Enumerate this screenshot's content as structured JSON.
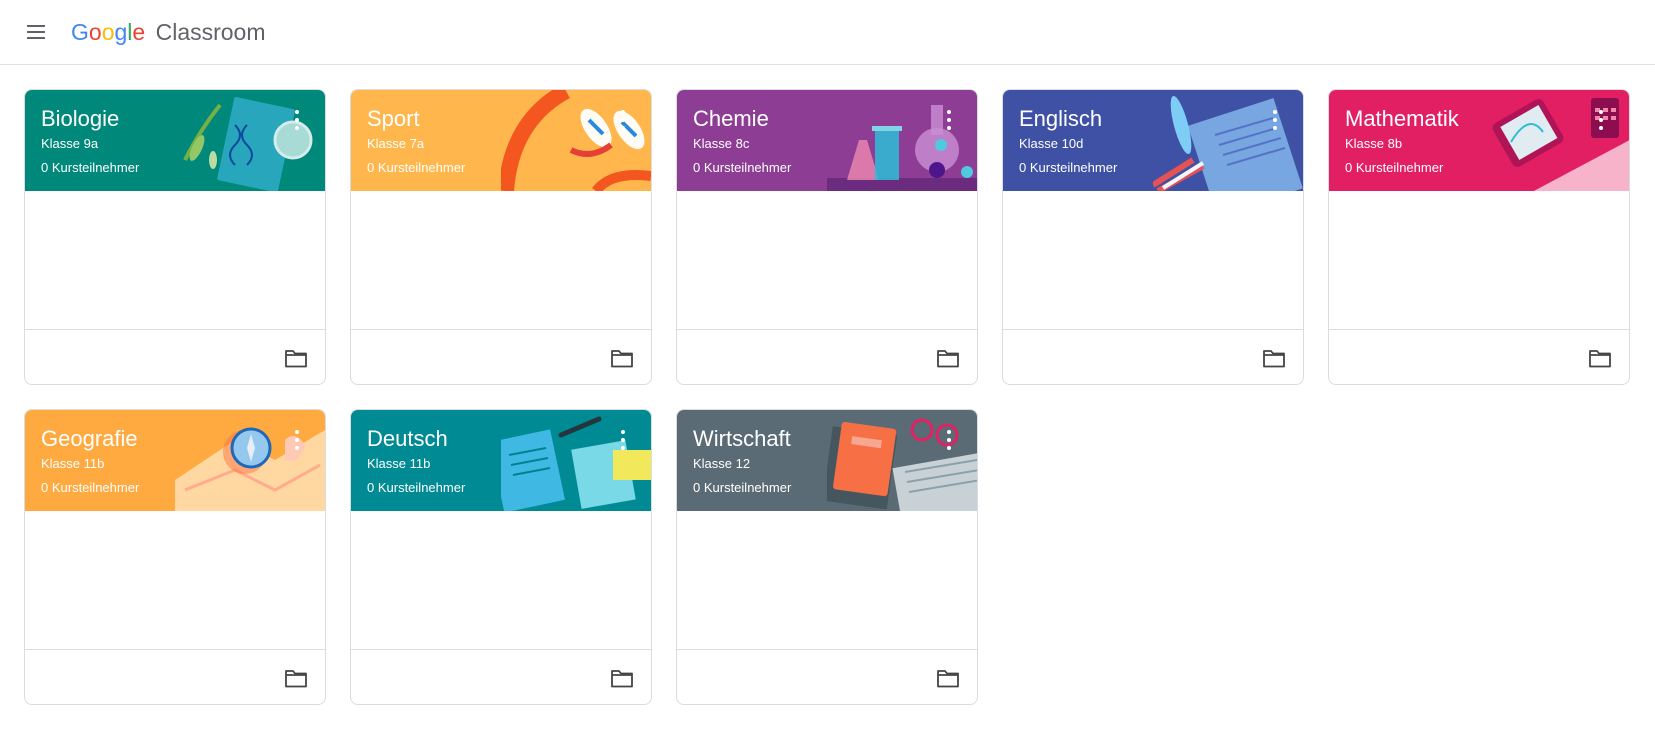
{
  "header": {
    "logo_google": [
      "G",
      "o",
      "o",
      "g",
      "l",
      "e"
    ],
    "logo_google_colors": [
      "#4285F4",
      "#EA4335",
      "#FBBC05",
      "#4285F4",
      "#34A853",
      "#EA4335"
    ],
    "logo_product": "Classroom",
    "menu_icon": "hamburger-menu-icon"
  },
  "courses": [
    {
      "title": "Biologie",
      "section": "Klasse 9a",
      "students": "0 Kursteilnehmer",
      "color": "#00897b",
      "art": "biology-illustration"
    },
    {
      "title": "Sport",
      "section": "Klasse 7a",
      "students": "0 Kursteilnehmer",
      "color": "#ffb74d",
      "art": "sport-illustration"
    },
    {
      "title": "Chemie",
      "section": "Klasse 8c",
      "students": "0 Kursteilnehmer",
      "color": "#8e3d94",
      "art": "chemistry-illustration"
    },
    {
      "title": "Englisch",
      "section": "Klasse 10d",
      "students": "0 Kursteilnehmer",
      "color": "#3f51a5",
      "art": "english-illustration"
    },
    {
      "title": "Mathematik",
      "section": "Klasse 8b",
      "students": "0 Kursteilnehmer",
      "color": "#e21f63",
      "art": "math-illustration"
    },
    {
      "title": "Geografie",
      "section": "Klasse 11b",
      "students": "0 Kursteilnehmer",
      "color": "#ffaa40",
      "art": "geography-illustration"
    },
    {
      "title": "Deutsch",
      "section": "Klasse 11b",
      "students": "0 Kursteilnehmer",
      "color": "#008a94",
      "art": "german-illustration"
    },
    {
      "title": "Wirtschaft",
      "section": "Klasse 12",
      "students": "0 Kursteilnehmer",
      "color": "#5a6b75",
      "art": "economics-illustration"
    }
  ],
  "icons": {
    "more": "more-vert-icon",
    "folder": "folder-icon"
  }
}
